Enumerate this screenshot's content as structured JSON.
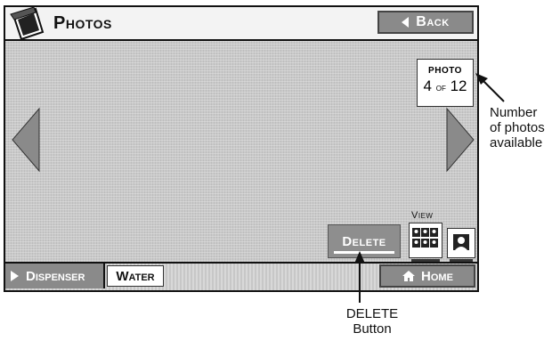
{
  "titlebar": {
    "title": "Photos",
    "back_label": "Back"
  },
  "photo_counter": {
    "label": "PHOTO",
    "current": "4",
    "of": "of",
    "total": "12"
  },
  "actions": {
    "delete_label": "Delete"
  },
  "view": {
    "label": "View"
  },
  "bottombar": {
    "dispenser_label": "Dispenser",
    "water_label": "Water",
    "home_label": "Home"
  },
  "callouts": {
    "count_line1": "Number",
    "count_line2": "of photos",
    "count_line3": "available",
    "delete_line1": "DELETE",
    "delete_line2": "Button"
  },
  "icons": {
    "app": "photos-icon",
    "back": "left-triangle-icon",
    "prev": "left-arrow-icon",
    "next": "right-arrow-icon",
    "grid_view": "grid-view-icon",
    "single_view": "single-view-icon",
    "dispenser": "right-triangle-icon",
    "home": "house-icon"
  }
}
